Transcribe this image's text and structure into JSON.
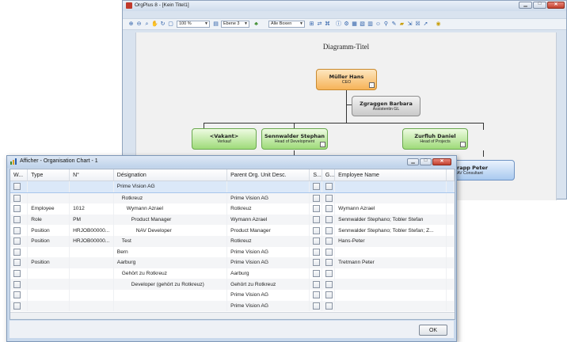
{
  "orgplus": {
    "title": "OrgPlus 8 - [Kein Titel1]",
    "zoom": "100 %",
    "level": "Ebene 3",
    "boxes_filter": "Alle Boxen",
    "diagram_title": "Diagramm-Titel",
    "nodes": [
      {
        "name": "Müller Hans",
        "role": "CEO",
        "color": "orange"
      },
      {
        "name": "Zgraggen Barbara",
        "role": "Assistentin GL",
        "color": "gray"
      },
      {
        "name": "<Vakant>",
        "role": "Verkauf",
        "color": "green"
      },
      {
        "name": "Sennwalder Stephan",
        "role": "Head of Development",
        "color": "green"
      },
      {
        "name": "Zurfluh Daniel",
        "role": "Head of Projects",
        "color": "green"
      },
      {
        "name": "rapp Peter",
        "role": "AV Consultant",
        "color": "blue"
      }
    ],
    "colors": {
      "accent_orange": "#f6b358",
      "green": "#9edb79",
      "gray": "#c9c9c9"
    }
  },
  "dialog": {
    "title": "Afficher - Organisation Chart - 1",
    "ok_label": "OK",
    "columns": [
      "W...",
      "Type",
      "N°",
      "Désignation",
      "Parent Org. Unit Desc.",
      "S...",
      "G...",
      "Employee Name"
    ],
    "rows": [
      {
        "type": "",
        "no": "",
        "designation": "Prime Vision AG",
        "indent": 0,
        "parent": "",
        "employee": "",
        "selected": true
      },
      {
        "type": "",
        "no": "",
        "designation": "Rotkreuz",
        "indent": 1,
        "parent": "Prime Vision AG",
        "employee": ""
      },
      {
        "type": "Employee",
        "no": "1012",
        "designation": "Wymann Azrael",
        "indent": 2,
        "parent": "Rotkreuz",
        "employee": "Wymann Azrael"
      },
      {
        "type": "Role",
        "no": "PM",
        "designation": "Product Manager",
        "indent": 3,
        "parent": "Wymann Azrael",
        "employee": "Sennwalder Stephano; Tobler Stefan"
      },
      {
        "type": "Position",
        "no": "HRJOB00000...",
        "designation": "NAV Developer",
        "indent": 4,
        "parent": "Product Manager",
        "employee": "Sennwalder Stephano; Tobler Stefan; Z..."
      },
      {
        "type": "Position",
        "no": "HRJOB00000...",
        "designation": "Test",
        "indent": 1,
        "parent": "Rotkreuz",
        "employee": "Hans-Peter"
      },
      {
        "type": "",
        "no": "",
        "designation": "Bern",
        "indent": 0,
        "parent": "Prime Vision AG",
        "employee": ""
      },
      {
        "type": "Position",
        "no": "",
        "designation": "Aarburg",
        "indent": 0,
        "parent": "Prime Vision AG",
        "employee": "Tretmann Peter"
      },
      {
        "type": "",
        "no": "",
        "designation": "Gehört zu Rotkreuz",
        "indent": 1,
        "parent": "Aarburg",
        "employee": ""
      },
      {
        "type": "",
        "no": "",
        "designation": "Developer (gehört zu Rotkreuz)",
        "indent": 3,
        "parent": "Gehört zu Rotkreuz",
        "employee": ""
      },
      {
        "type": "",
        "no": "",
        "designation": "",
        "indent": 0,
        "parent": "Prime Vision AG",
        "employee": ""
      },
      {
        "type": "",
        "no": "",
        "designation": "",
        "indent": 0,
        "parent": "Prime Vision AG",
        "employee": ""
      }
    ]
  }
}
